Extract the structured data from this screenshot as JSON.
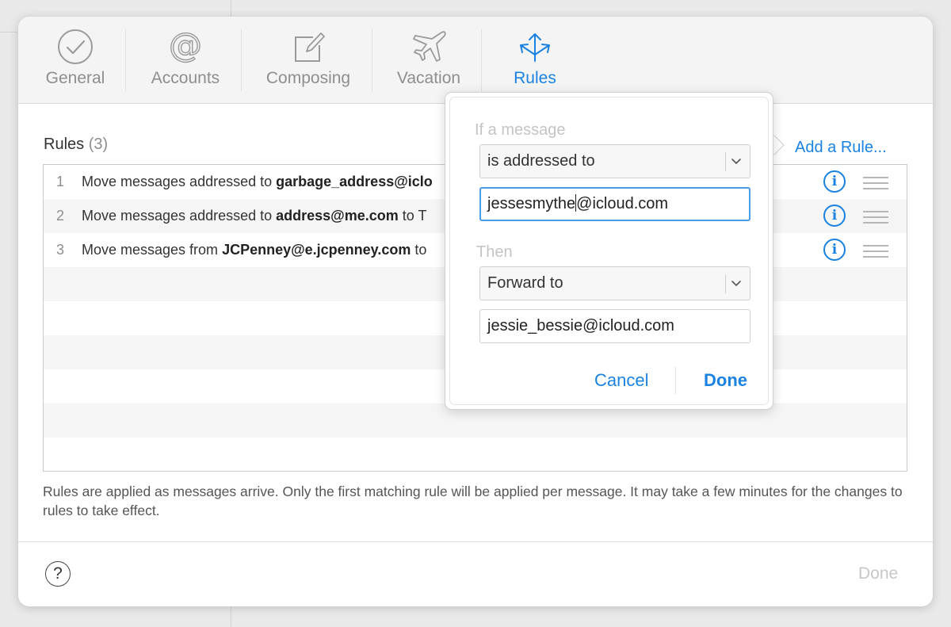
{
  "toolbar": {
    "tabs": [
      {
        "label": "General",
        "icon": "checkmark-circle-icon"
      },
      {
        "label": "Accounts",
        "icon": "at-sign-icon"
      },
      {
        "label": "Composing",
        "icon": "compose-icon"
      },
      {
        "label": "Vacation",
        "icon": "airplane-icon"
      },
      {
        "label": "Rules",
        "icon": "rules-arrows-icon",
        "active": true
      }
    ]
  },
  "rules": {
    "heading": "Rules",
    "count": "(3)",
    "add_label": "Add a Rule...",
    "items": [
      {
        "num": "1",
        "prefix": "Move messages addressed to ",
        "bold": "garbage_address@iclo",
        "suffix": ""
      },
      {
        "num": "2",
        "prefix": "Move messages addressed to ",
        "bold": "address@me.com",
        "suffix": " to T"
      },
      {
        "num": "3",
        "prefix": "Move messages from ",
        "bold": "JCPenney@e.jcpenney.com",
        "suffix": " to"
      }
    ],
    "footnote": "Rules are applied as messages arrive. Only the first matching rule will be applied per message. It may take a few minutes for the changes to rules to take effect."
  },
  "footer": {
    "help_glyph": "?",
    "done_label": "Done"
  },
  "popover": {
    "condition_label": "If a message",
    "condition_value": "is addressed to",
    "condition_input_before_caret": "jessesmythe",
    "condition_input_after_caret": "@icloud.com",
    "action_label": "Then",
    "action_value": "Forward to",
    "action_input": "jessie_bessie@icloud.com",
    "cancel_label": "Cancel",
    "done_label": "Done"
  },
  "colors": {
    "accent": "#1a82e0",
    "inactive_tab": "#8e8e8e",
    "disabled": "#c7c7c7"
  }
}
